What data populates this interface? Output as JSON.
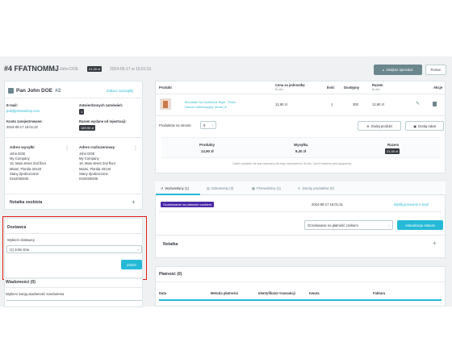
{
  "header": {
    "order_ref": "#4 FFATNOMMJ",
    "from_label": "od John DOE",
    "total_badge": "21,30 zł",
    "date": "2024-05-17 w 15:01:31",
    "change_status_btn": "Zwiększ sprzedaż",
    "help_btn": "Pomoc"
  },
  "customer": {
    "name": "Pan John DOE",
    "id": "#2",
    "details_link": "Zobacz szczegóły",
    "email_label": "E-mail:",
    "email": "pub@prestashop.com",
    "validated_orders_label": "Zatwierdzonych zamówień:",
    "validated_orders": "1",
    "registered_label": "Konto zarejestrowane:",
    "registered": "2024-05-17 15:01:22",
    "spent_label": "Razem wydane od rejestracji:",
    "spent": "169,90 zł",
    "ship_title": "Adres wysyłki",
    "ship_lines": [
      "John DOE",
      "My Company",
      "16, Main street 2nd floor",
      "Miami, Florida 33133",
      "Stany Zjednoczone",
      "0102030405"
    ],
    "bill_title": "Adres rozliczeniowy",
    "bill_lines": [
      "John DOE",
      "My Company",
      "16, Main street 2nd floor",
      "Miami, Florida 33133",
      "Stany Zjednoczone",
      "0102030405"
    ],
    "private_note": "Notatka osobista"
  },
  "supplier": {
    "title": "Dostawca",
    "select_label": "Wybierz dostawcę",
    "selected": "(1) John Doe",
    "change_btn": "Zmień"
  },
  "messages": {
    "title": "Wiadomości (0)",
    "select_label": "Wybierz swoją wiadomość zamówienia"
  },
  "products": {
    "col_product": "Produkt",
    "col_unit_price": "Cena za jednostkę",
    "col_unit_sub": "Brutto",
    "col_qty": "Ilość",
    "col_available": "Dostępny",
    "col_total": "Razem",
    "col_total_sub": "Brutto",
    "col_actions": "Akcje",
    "row_name_1": "Mountain fox notebook Style : Plain",
    "row_name_2": "Numer referencyjny: demo_8",
    "row_price": "12,90 zł",
    "row_qty": "1",
    "row_available": "300",
    "row_total": "12,90 zł",
    "per_page_label": "Produktów na stronie:",
    "per_page": "8",
    "add_product_btn": "Dodaj produkt",
    "add_discount_btn": "Dodaj rabat",
    "sum_products_label": "Produkty",
    "sum_products": "12,90 zł",
    "sum_shipping_label": "Wysyłka",
    "sum_shipping": "8,40 zł",
    "sum_total_label": "Razem",
    "sum_total": "21,30 zł",
    "tax_note": "Żaden podatek nie jest naliczany dla tego zamówienia. Brutto. Zwrot towarów jest wyłączony."
  },
  "tabs": {
    "status": "Wyświetlany (1)",
    "documents": "Dokumenty (0)",
    "carriers": "Przewoźnicy (1)",
    "returns": "Zwroty produktów (0)"
  },
  "status": {
    "badge": "Oczekiwanie na płatność czekiem",
    "date": "2024-05-17 15:01:31",
    "resend_link": "Wyślij ponownie e-mail",
    "select_value": "Oczekiwanie na płatność czekiem",
    "update_btn": "Aktualizacja statusu",
    "note": "Notatka"
  },
  "payment": {
    "title": "Płatność (0)",
    "col_date": "Data",
    "col_method": "Metoda płatności",
    "col_tx": "Identyfikator transakcji",
    "col_amount": "Kwota",
    "col_invoice": "Faktura"
  },
  "colors": {
    "accent": "#25b9d7",
    "highlight": "#e0201c",
    "status_purple": "#4a2aa8"
  }
}
